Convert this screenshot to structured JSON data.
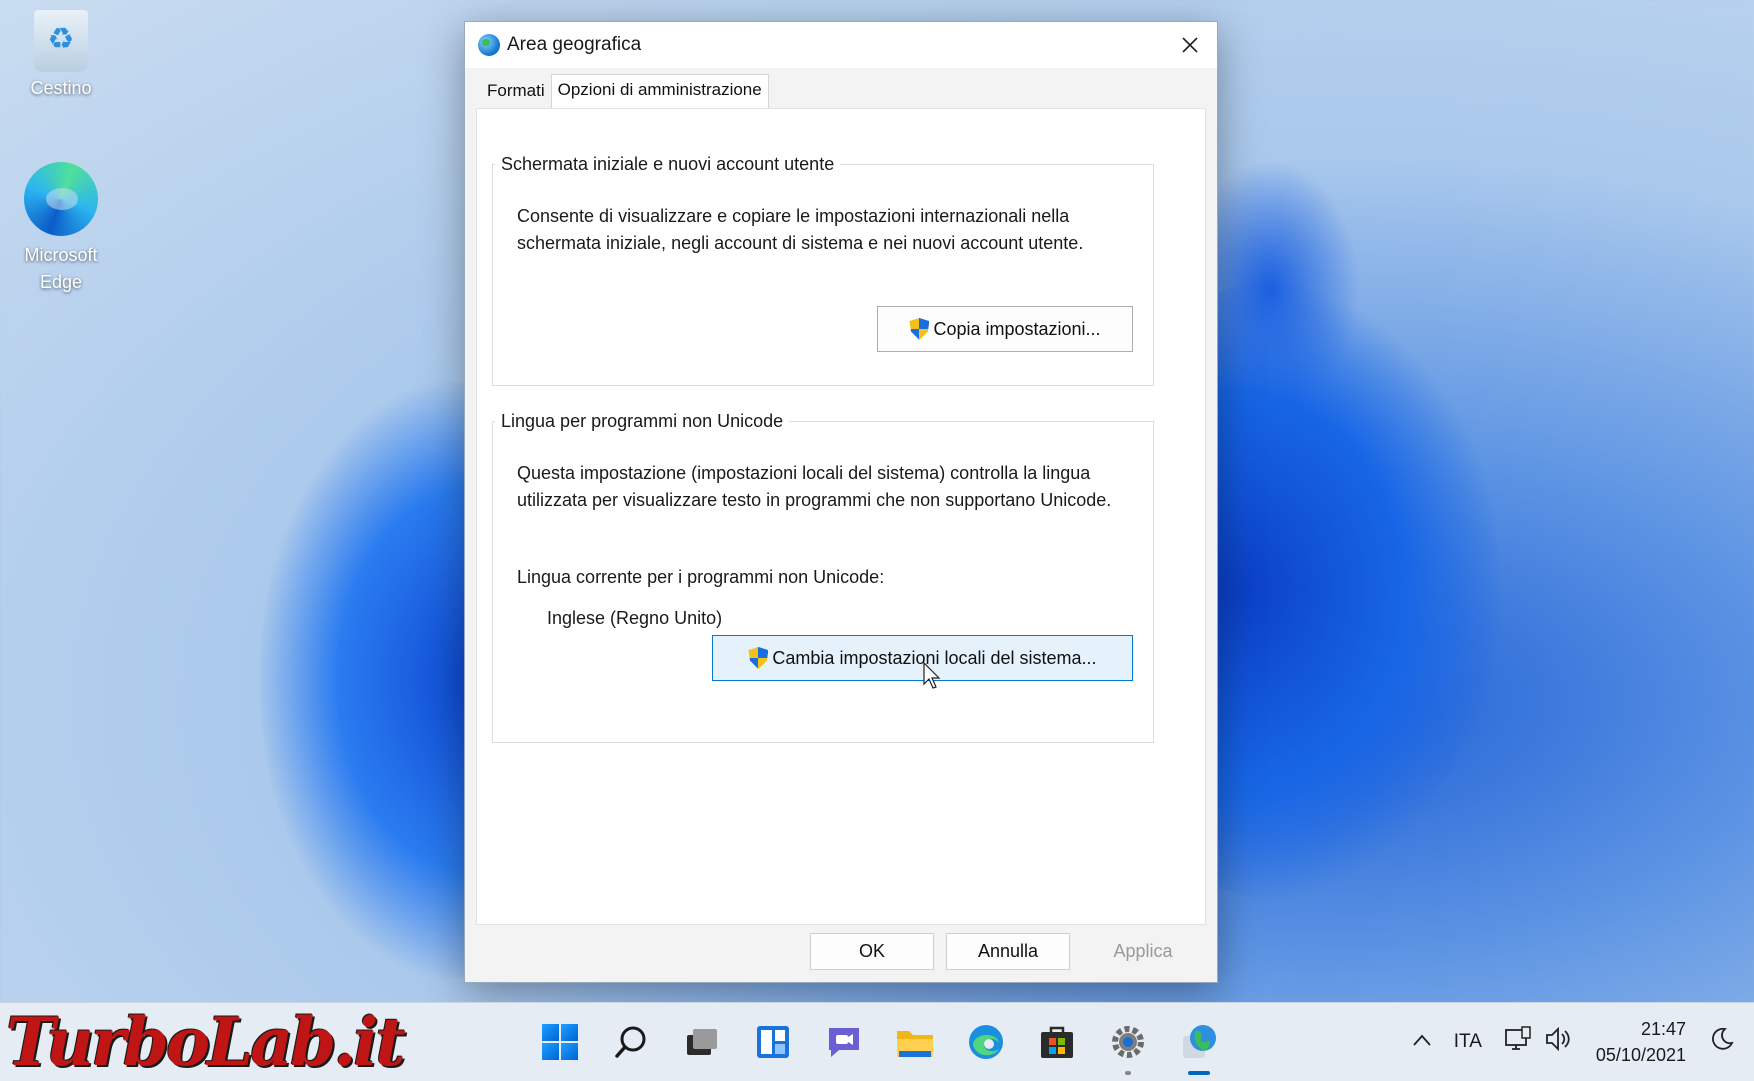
{
  "desktop": {
    "icons": [
      {
        "label": "Cestino"
      },
      {
        "label": "Microsoft Edge"
      }
    ]
  },
  "dialog": {
    "title": "Area geografica",
    "tabs": [
      {
        "label": "Formati",
        "active": false
      },
      {
        "label": "Opzioni di amministrazione",
        "active": true
      }
    ],
    "welcome": {
      "legend": "Schermata iniziale e nuovi account utente",
      "description": "Consente di visualizzare e copiare le impostazioni internazionali nella schermata iniziale, negli account di sistema e nei nuovi account utente.",
      "button": "Copia impostazioni..."
    },
    "unicode": {
      "legend": "Lingua per programmi non Unicode",
      "description": "Questa impostazione (impostazioni locali del sistema) controlla la lingua utilizzata per visualizzare testo in programmi che non supportano Unicode.",
      "current_label": "Lingua corrente per i programmi non Unicode:",
      "current_value": "Inglese (Regno Unito)",
      "button": "Cambia impostazioni locali del sistema..."
    },
    "buttons": {
      "ok": "OK",
      "cancel": "Annulla",
      "apply": "Applica"
    }
  },
  "taskbar": {
    "watermark": "TurboLab.it",
    "language": "ITA",
    "time": "21:47",
    "date": "05/10/2021"
  }
}
